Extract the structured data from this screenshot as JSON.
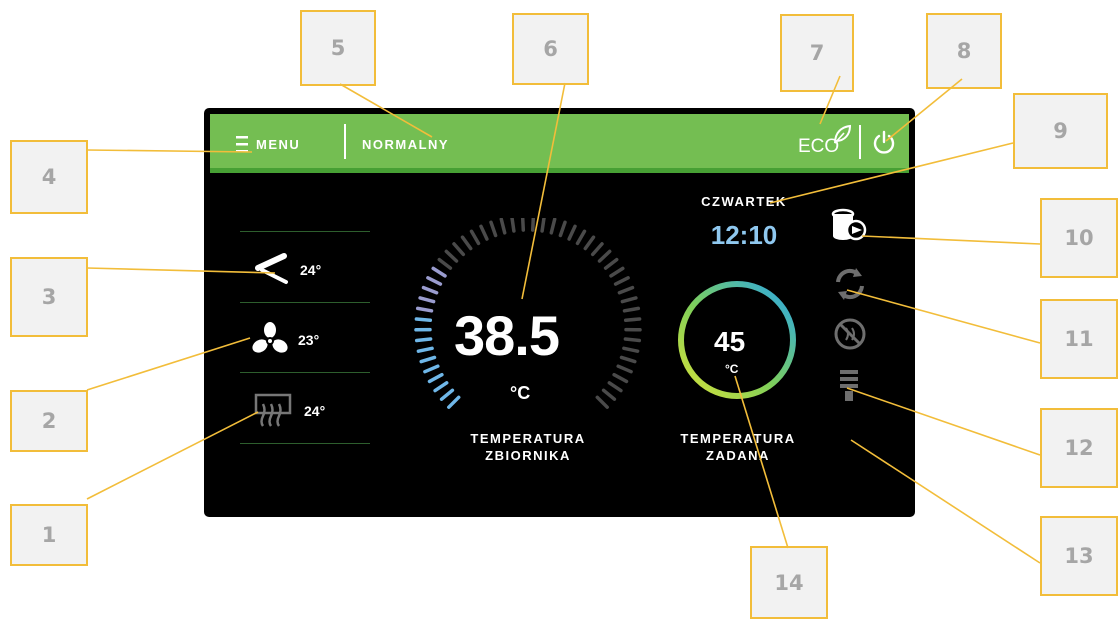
{
  "topbar": {
    "menu_label": "MENU",
    "mode_label": "NORMALNY",
    "eco_label": "ECO"
  },
  "left_panel": {
    "valve_temp": "24°",
    "fan_temp": "23°",
    "heater_temp": "24°"
  },
  "main": {
    "tank_temp_value": "38.5",
    "tank_temp_unit": "°C",
    "tank_label_line1": "TEMPERATURA",
    "tank_label_line2": "ZBIORNIKA",
    "set_temp_value": "45",
    "set_temp_unit": "°C",
    "set_label_line1": "TEMPERATURA",
    "set_label_line2": "ZADANA"
  },
  "clock": {
    "day": "CZWARTEK",
    "time": "12:10"
  },
  "callouts": [
    "1",
    "2",
    "3",
    "4",
    "5",
    "6",
    "7",
    "8",
    "9",
    "10",
    "11",
    "12",
    "13",
    "14"
  ],
  "colors": {
    "topbar": "#74be52",
    "topbar_border": "#47a034",
    "screen_bg": "#000000",
    "callout_border": "#f2bd3a",
    "callout_text": "#a6a6a6",
    "time_color": "#8fc8ef"
  },
  "icons": [
    "menu-icon",
    "eco-leaf-icon",
    "power-icon",
    "valve-icon",
    "fan-icon",
    "heater-icon",
    "tank-pump-icon",
    "circulation-icon",
    "disabled-icon",
    "hot-water-icon"
  ]
}
